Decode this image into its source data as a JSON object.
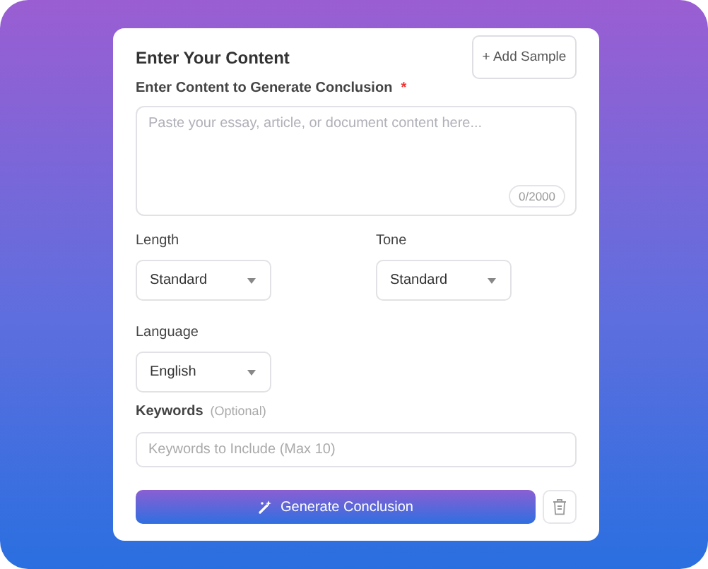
{
  "card": {
    "title": "Enter Your Content",
    "add_sample_button": "+ Add Sample"
  },
  "content": {
    "label": "Enter Content to Generate Conclusion",
    "required_mark": "*",
    "placeholder": "Paste your essay, article, or document content here...",
    "counter": "0/2000"
  },
  "options": [
    {
      "label": "Length",
      "value": "Standard"
    },
    {
      "label": "Tone",
      "value": "Standard"
    },
    {
      "label": "Language",
      "value": "English"
    }
  ],
  "keywords": {
    "label": "Keywords",
    "hint": "(Optional)",
    "placeholder": "Keywords to Include (Max 10)"
  },
  "generate_button": "Generate Conclusion"
}
